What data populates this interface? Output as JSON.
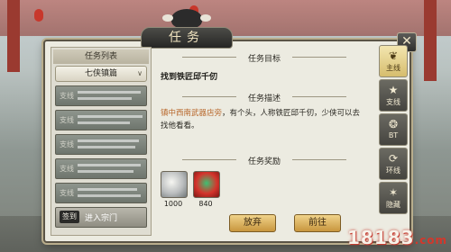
{
  "window": {
    "title": "任务",
    "close": "✕"
  },
  "task_list": {
    "header": "任务列表",
    "dropdown": "七侠镇篇",
    "items": [
      {
        "type": "支线"
      },
      {
        "type": "支线"
      },
      {
        "type": "支线"
      },
      {
        "type": "支线"
      },
      {
        "type": "支线"
      },
      {
        "badge": "签到",
        "label": "进入宗门"
      }
    ]
  },
  "detail": {
    "goal_title": "任务目标",
    "goal_text": "找到铁匠邱千仞",
    "desc_title": "任务描述",
    "desc_highlight": "镇中西南武器店旁",
    "desc_rest": "，有个头，人称铁匠邱千仞，少侠可以去找他看看。",
    "reward_title": "任务奖励",
    "rewards": [
      {
        "amount": "1000"
      },
      {
        "amount": "840"
      }
    ],
    "buttons": {
      "abandon": "放弃",
      "go": "前往"
    }
  },
  "tabs": [
    {
      "label": "主线",
      "icon": "main-icon"
    },
    {
      "label": "支线",
      "icon": "branch-icon"
    },
    {
      "label": "BT",
      "icon": "bt-icon"
    },
    {
      "label": "环线",
      "icon": "loop-icon"
    },
    {
      "label": "隐藏",
      "icon": "hidden-icon"
    }
  ],
  "watermark": {
    "main": "18183",
    "sub": ".com"
  },
  "colors": {
    "accent": "#d6bd6d",
    "highlight": "#b8672b"
  }
}
